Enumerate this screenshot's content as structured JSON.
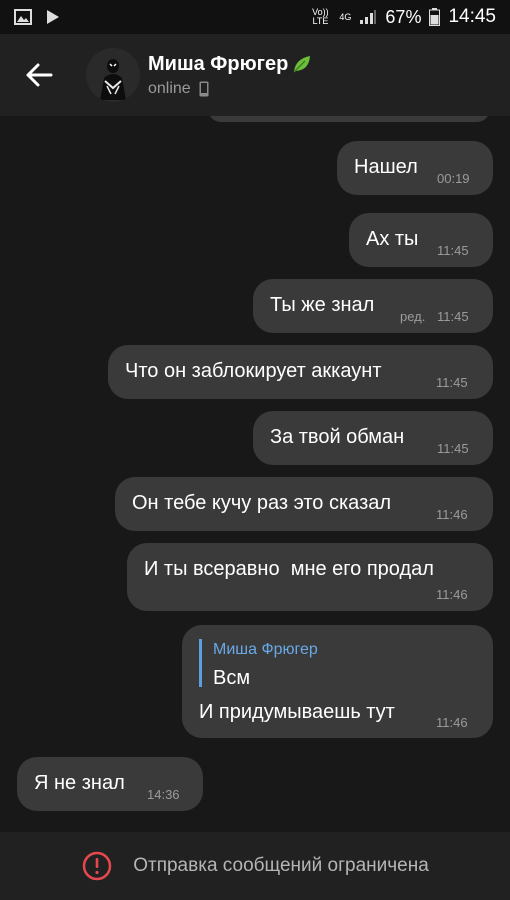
{
  "status_bar": {
    "volte": "Vo)) LTE",
    "network": "4G",
    "battery": "67%",
    "time": "14:45",
    "icons": [
      "image-icon",
      "play-icon",
      "volte-icon",
      "signal-icon",
      "battery-icon"
    ]
  },
  "header": {
    "name": "Миша Фрюгер",
    "status": "online",
    "icons": [
      "back-arrow-icon",
      "leaf-icon",
      "phone-icon"
    ]
  },
  "messages": [
    {
      "text": "Нашел",
      "time": "00:19",
      "outgoing": true
    },
    {
      "text": "Ах ты",
      "time": "11:45",
      "outgoing": true
    },
    {
      "text": "Ты же знал",
      "edited": "ред.",
      "time": "11:45",
      "outgoing": true
    },
    {
      "text": "Что он заблокирует аккаунт",
      "time": "11:45",
      "outgoing": true
    },
    {
      "text": "За твой обман",
      "time": "11:45",
      "outgoing": true
    },
    {
      "text": "Он тебе кучу раз это сказал",
      "time": "11:46",
      "outgoing": true
    },
    {
      "text": "И ты всеравно  мне его продал",
      "time": "11:46",
      "outgoing": true
    },
    {
      "reply_name": "Миша Фрюгер",
      "reply_text": "Всм",
      "text": "И придумываешь тут",
      "time": "11:46",
      "outgoing": true
    },
    {
      "text": "Я не знал",
      "time": "14:36",
      "outgoing": false
    }
  ],
  "bottom": {
    "restriction": "Отправка сообщений ограничена",
    "icon": "alert-icon",
    "alert_color": "#e5484d"
  },
  "colors": {
    "background": "#181818",
    "header": "#212121",
    "bubble": "#3a3a3a",
    "reply_accent": "#6aa9e8"
  }
}
